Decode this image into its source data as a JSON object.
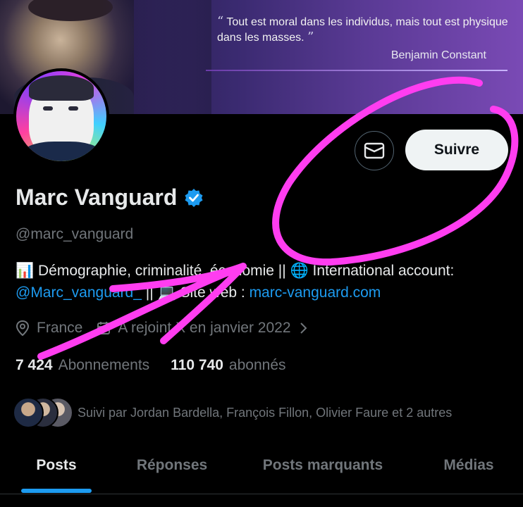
{
  "banner": {
    "quote_open": "“",
    "quote_text": "Tout est moral dans les individus, mais tout est physique dans les masses.",
    "quote_close": "”",
    "quote_author": "Benjamin Constant"
  },
  "actions": {
    "message_icon": "envelope-icon",
    "follow_label": "Suivre"
  },
  "profile": {
    "name": "Marc Vanguard",
    "verified_icon": "verified-badge-icon",
    "handle": "@marc_vanguard",
    "bio_emoji_1": "📊",
    "bio_part_1": " Démographie, criminalité, économie || ",
    "bio_emoji_2": "🌐",
    "bio_part_2": " International account: ",
    "bio_link_1": "@Marc_vanguard_",
    "bio_part_3": " || ",
    "bio_emoji_3": "💻",
    "bio_part_4": " Site web : ",
    "bio_link_2": "marc-vanguard.com",
    "location": "France",
    "joined": "A rejoint X en janvier 2022"
  },
  "stats": {
    "following_count": "7 424",
    "following_label": "Abonnements",
    "followers_count": "110 740",
    "followers_label": "abonnés"
  },
  "followed_by": {
    "text": "Suivi par Jordan Bardella, François Fillon, Olivier Faure et 2 autres"
  },
  "tabs": [
    {
      "label": "Posts",
      "active": true
    },
    {
      "label": "Réponses",
      "active": false
    },
    {
      "label": "Posts marquants",
      "active": false
    },
    {
      "label": "Médias",
      "active": false
    }
  ],
  "colors": {
    "accent": "#1d9bf0",
    "annotation": "#ff3df0",
    "muted": "#71767b"
  }
}
